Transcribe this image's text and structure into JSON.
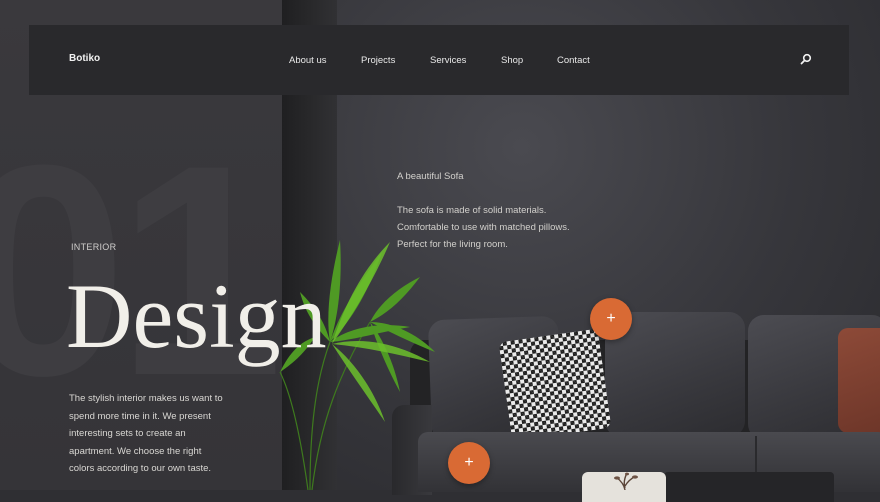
{
  "brand": {
    "logo": "Botiko"
  },
  "nav": {
    "items": [
      {
        "label": "About us"
      },
      {
        "label": "Projects"
      },
      {
        "label": "Services"
      },
      {
        "label": "Shop"
      },
      {
        "label": "Contact"
      }
    ],
    "search_icon": "search-icon"
  },
  "hero": {
    "number": "01",
    "eyebrow": "INTERIOR",
    "title": "Design",
    "intro": "The stylish interior makes us want to spend more time in it. We present interesting sets to create an apartment. We choose the right colors according to our own taste."
  },
  "product": {
    "title": "A beautiful Sofa",
    "lines": [
      "The sofa is made of solid materials.",
      "Comfortable to use with matched pillows.",
      "Perfect for the living room."
    ]
  },
  "hotspots": [
    {
      "label": "+"
    },
    {
      "label": "+"
    }
  ],
  "colors": {
    "accent": "#d96a34",
    "background": "#2f2f33",
    "navbar": "#29292c"
  }
}
